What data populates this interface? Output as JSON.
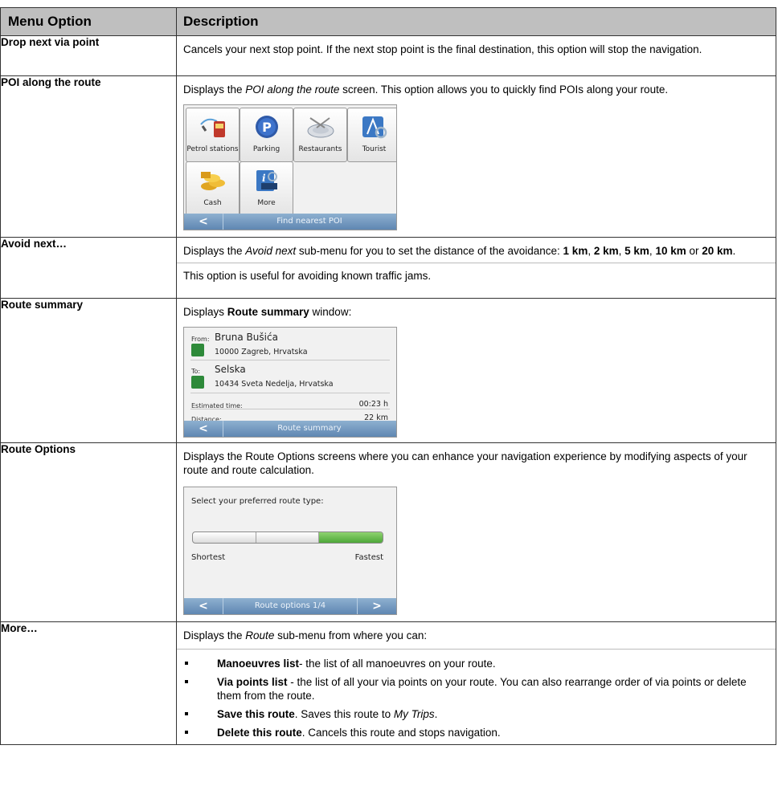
{
  "header": {
    "menu_option": "Menu Option",
    "description": "Description"
  },
  "rows": {
    "drop": {
      "option": "Drop next via point",
      "text": "Cancels your next stop point. If the next stop point is the final destination, this option will stop the navigation."
    },
    "poi": {
      "option": "POI along the route",
      "text_pre": "Displays the ",
      "text_em": "POI along the route",
      "text_post": " screen. This option allows you to quickly find POIs along your route.",
      "buttons": [
        "Petrol stations",
        "Parking",
        "Restaurants",
        "Tourist",
        "Cash",
        "More"
      ],
      "bar_title": "Find nearest POI",
      "back_glyph": "<"
    },
    "avoid": {
      "option": "Avoid next…",
      "t1": "Displays the ",
      "t1_em": "Avoid next",
      "t2": " sub-menu for you to set the distance of the avoidance: ",
      "d1": "1 km",
      "d2": "2 km",
      "d3": "5 km",
      "d4": "10 km",
      "or": " or ",
      "d5": "20 km",
      "sep": ", ",
      "period": ".",
      "note": "This option is useful for avoiding known traffic jams."
    },
    "summary": {
      "option": "Route summary",
      "text_pre": "Displays ",
      "text_bold": "Route summary",
      "text_post": " window:",
      "from_label": "From:",
      "from_name": "Bruna Bušića",
      "from_addr": "10000 Zagreb, Hrvatska",
      "to_label": "To:",
      "to_name": "Selska",
      "to_addr": "10434 Sveta Nedelja, Hrvatska",
      "est_label": "Estimated time:",
      "est_value": "00:23 h",
      "dist_label": "Distance:",
      "dist_value": "22 km",
      "bar_title": "Route summary"
    },
    "options": {
      "option": "Route Options",
      "text": "Displays the Route Options screens where you can enhance your navigation experience by modifying aspects of your route and route calculation.",
      "prompt": "Select your preferred route type:",
      "left_label": "Shortest",
      "right_label": "Fastest",
      "slider_level": 1.0,
      "bar_title": "Route options 1/4",
      "fwd_glyph": ">"
    },
    "more": {
      "option": "More…",
      "intro_pre": "Displays the ",
      "intro_em": "Route",
      "intro_post": " sub-menu from where you can:",
      "b1_bold": "Manoeuvres list",
      "b1_text": "- the list of all manoeuvres on your route.",
      "b2_bold": "Via points list",
      "b2_text": " - the list of all your via points on your route. You can also rearrange order of via points or delete them from the route.",
      "b3_bold": "Save this route",
      "b3_text": ". Saves this route to ",
      "b3_em": "My Trips",
      "b3_end": ".",
      "b4_bold": "Delete this route",
      "b4_text": ". Cancels this route and stops navigation."
    }
  },
  "colors": {
    "header_bg": "#bfbfbf",
    "nav_bar": "#6f95bd",
    "slider_green": "#5db347",
    "poi_icon_green": "#2e8a3a"
  }
}
